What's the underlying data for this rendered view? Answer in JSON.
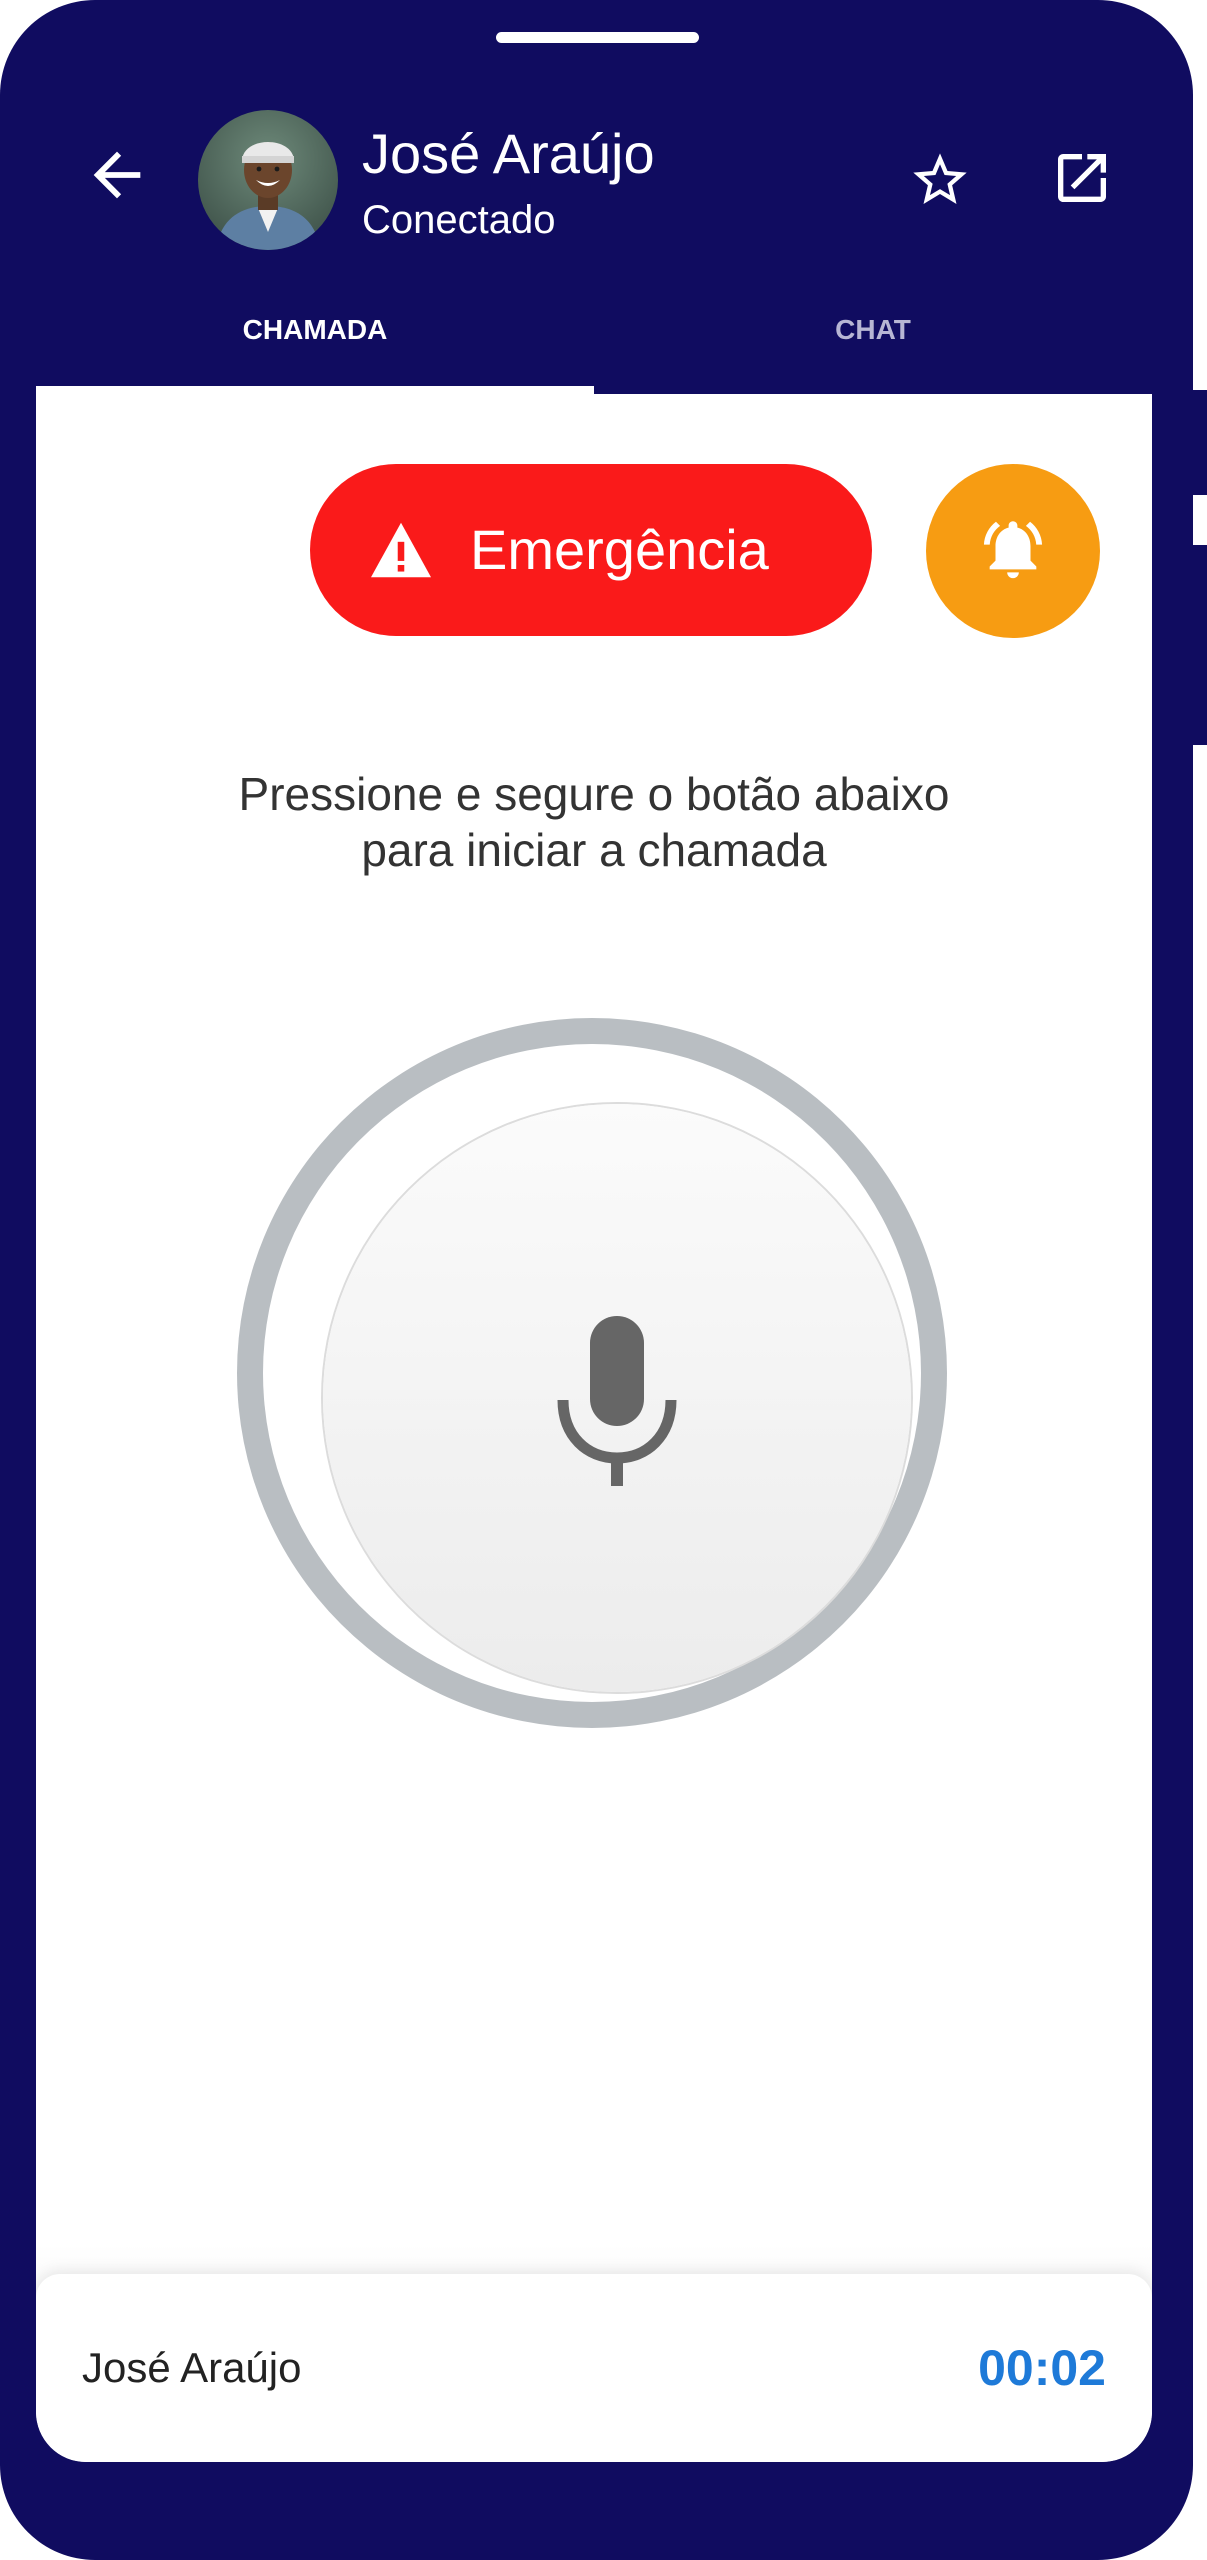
{
  "header": {
    "contact_name": "José Araújo",
    "status": "Conectado"
  },
  "tabs": [
    {
      "label": "CHAMADA",
      "active": true
    },
    {
      "label": "CHAT",
      "active": false
    }
  ],
  "actions": {
    "emergency_label": "Emergência",
    "emergency_color": "#fa1a1a",
    "alarm_color": "#f79c12"
  },
  "instruction": {
    "line1": "Pressione e segure o botão abaixo",
    "line2": "para iniciar a chamada"
  },
  "footer": {
    "contact_name": "José Araújo",
    "timer": "00:02",
    "timer_color": "#1e7ad8"
  },
  "colors": {
    "frame": "#100c60"
  },
  "icons": [
    "arrow-left-icon",
    "star-icon",
    "open-external-icon",
    "warning-icon",
    "alarm-bell-icon",
    "microphone-icon"
  ]
}
